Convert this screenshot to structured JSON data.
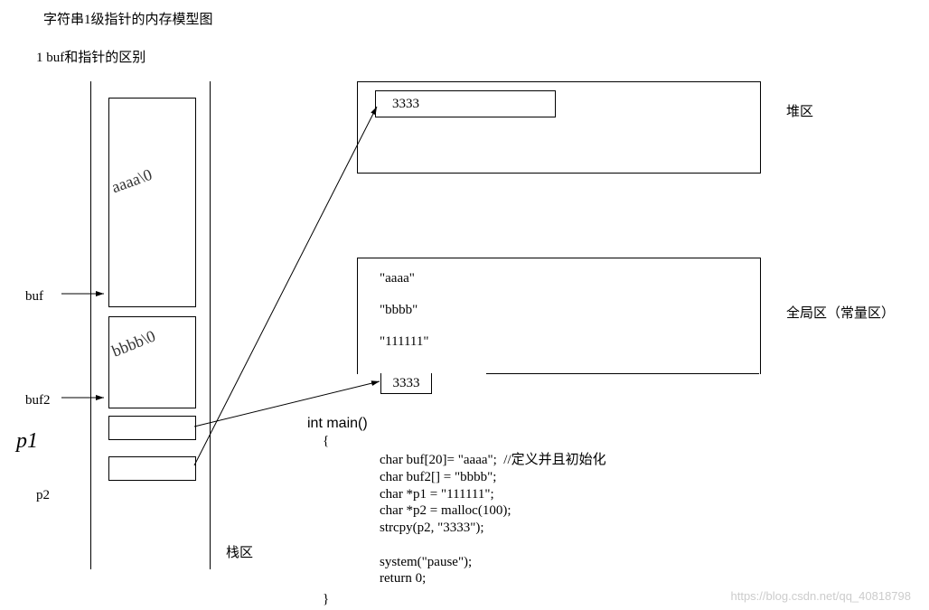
{
  "title": "字符串1级指针的内存模型图",
  "subtitle": "1 buf和指针的区别",
  "stack": {
    "label": "栈区",
    "buf_label": "buf",
    "buf2_label": "buf2",
    "p1_label": "p1",
    "p2_label": "p2",
    "scribble1": "aaaa\\0",
    "scribble2": "bbbb\\0"
  },
  "heap": {
    "region_label": "堆区",
    "cell_value": "3333"
  },
  "global": {
    "region_label": "全局区（常量区）",
    "literals": {
      "a": "\"aaaa\"",
      "b": "\"bbbb\"",
      "c": "\"111111\"",
      "d": "3333"
    }
  },
  "code": {
    "signature": "int main()",
    "brace_open": "{",
    "brace_close": "}",
    "body": "char buf[20]= \"aaaa\";  //定义并且初始化\nchar buf2[] = \"bbbb\";\nchar *p1 = \"111111\";\nchar *p2 = malloc(100);\nstrcpy(p2, \"3333\");\n\nsystem(\"pause\");\nreturn 0;"
  },
  "watermark": "https://blog.csdn.net/qq_40818798"
}
